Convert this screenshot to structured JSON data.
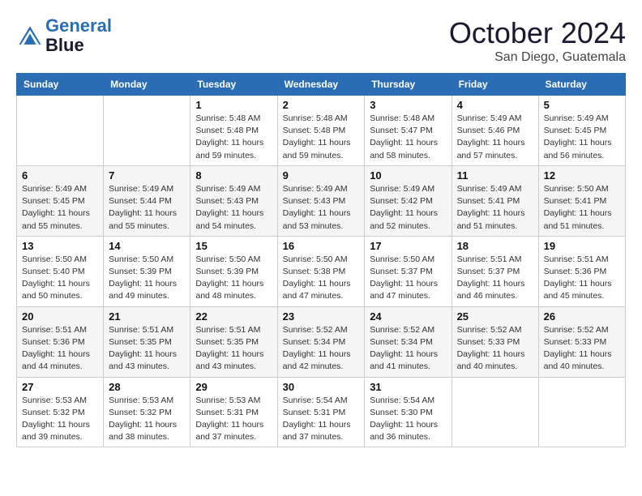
{
  "header": {
    "logo_line1": "General",
    "logo_line2": "Blue",
    "month": "October 2024",
    "location": "San Diego, Guatemala"
  },
  "weekdays": [
    "Sunday",
    "Monday",
    "Tuesday",
    "Wednesday",
    "Thursday",
    "Friday",
    "Saturday"
  ],
  "weeks": [
    [
      {
        "day": "",
        "sunrise": "",
        "sunset": "",
        "daylight": ""
      },
      {
        "day": "",
        "sunrise": "",
        "sunset": "",
        "daylight": ""
      },
      {
        "day": "1",
        "sunrise": "Sunrise: 5:48 AM",
        "sunset": "Sunset: 5:48 PM",
        "daylight": "Daylight: 11 hours and 59 minutes."
      },
      {
        "day": "2",
        "sunrise": "Sunrise: 5:48 AM",
        "sunset": "Sunset: 5:48 PM",
        "daylight": "Daylight: 11 hours and 59 minutes."
      },
      {
        "day": "3",
        "sunrise": "Sunrise: 5:48 AM",
        "sunset": "Sunset: 5:47 PM",
        "daylight": "Daylight: 11 hours and 58 minutes."
      },
      {
        "day": "4",
        "sunrise": "Sunrise: 5:49 AM",
        "sunset": "Sunset: 5:46 PM",
        "daylight": "Daylight: 11 hours and 57 minutes."
      },
      {
        "day": "5",
        "sunrise": "Sunrise: 5:49 AM",
        "sunset": "Sunset: 5:45 PM",
        "daylight": "Daylight: 11 hours and 56 minutes."
      }
    ],
    [
      {
        "day": "6",
        "sunrise": "Sunrise: 5:49 AM",
        "sunset": "Sunset: 5:45 PM",
        "daylight": "Daylight: 11 hours and 55 minutes."
      },
      {
        "day": "7",
        "sunrise": "Sunrise: 5:49 AM",
        "sunset": "Sunset: 5:44 PM",
        "daylight": "Daylight: 11 hours and 55 minutes."
      },
      {
        "day": "8",
        "sunrise": "Sunrise: 5:49 AM",
        "sunset": "Sunset: 5:43 PM",
        "daylight": "Daylight: 11 hours and 54 minutes."
      },
      {
        "day": "9",
        "sunrise": "Sunrise: 5:49 AM",
        "sunset": "Sunset: 5:43 PM",
        "daylight": "Daylight: 11 hours and 53 minutes."
      },
      {
        "day": "10",
        "sunrise": "Sunrise: 5:49 AM",
        "sunset": "Sunset: 5:42 PM",
        "daylight": "Daylight: 11 hours and 52 minutes."
      },
      {
        "day": "11",
        "sunrise": "Sunrise: 5:49 AM",
        "sunset": "Sunset: 5:41 PM",
        "daylight": "Daylight: 11 hours and 51 minutes."
      },
      {
        "day": "12",
        "sunrise": "Sunrise: 5:50 AM",
        "sunset": "Sunset: 5:41 PM",
        "daylight": "Daylight: 11 hours and 51 minutes."
      }
    ],
    [
      {
        "day": "13",
        "sunrise": "Sunrise: 5:50 AM",
        "sunset": "Sunset: 5:40 PM",
        "daylight": "Daylight: 11 hours and 50 minutes."
      },
      {
        "day": "14",
        "sunrise": "Sunrise: 5:50 AM",
        "sunset": "Sunset: 5:39 PM",
        "daylight": "Daylight: 11 hours and 49 minutes."
      },
      {
        "day": "15",
        "sunrise": "Sunrise: 5:50 AM",
        "sunset": "Sunset: 5:39 PM",
        "daylight": "Daylight: 11 hours and 48 minutes."
      },
      {
        "day": "16",
        "sunrise": "Sunrise: 5:50 AM",
        "sunset": "Sunset: 5:38 PM",
        "daylight": "Daylight: 11 hours and 47 minutes."
      },
      {
        "day": "17",
        "sunrise": "Sunrise: 5:50 AM",
        "sunset": "Sunset: 5:37 PM",
        "daylight": "Daylight: 11 hours and 47 minutes."
      },
      {
        "day": "18",
        "sunrise": "Sunrise: 5:51 AM",
        "sunset": "Sunset: 5:37 PM",
        "daylight": "Daylight: 11 hours and 46 minutes."
      },
      {
        "day": "19",
        "sunrise": "Sunrise: 5:51 AM",
        "sunset": "Sunset: 5:36 PM",
        "daylight": "Daylight: 11 hours and 45 minutes."
      }
    ],
    [
      {
        "day": "20",
        "sunrise": "Sunrise: 5:51 AM",
        "sunset": "Sunset: 5:36 PM",
        "daylight": "Daylight: 11 hours and 44 minutes."
      },
      {
        "day": "21",
        "sunrise": "Sunrise: 5:51 AM",
        "sunset": "Sunset: 5:35 PM",
        "daylight": "Daylight: 11 hours and 43 minutes."
      },
      {
        "day": "22",
        "sunrise": "Sunrise: 5:51 AM",
        "sunset": "Sunset: 5:35 PM",
        "daylight": "Daylight: 11 hours and 43 minutes."
      },
      {
        "day": "23",
        "sunrise": "Sunrise: 5:52 AM",
        "sunset": "Sunset: 5:34 PM",
        "daylight": "Daylight: 11 hours and 42 minutes."
      },
      {
        "day": "24",
        "sunrise": "Sunrise: 5:52 AM",
        "sunset": "Sunset: 5:34 PM",
        "daylight": "Daylight: 11 hours and 41 minutes."
      },
      {
        "day": "25",
        "sunrise": "Sunrise: 5:52 AM",
        "sunset": "Sunset: 5:33 PM",
        "daylight": "Daylight: 11 hours and 40 minutes."
      },
      {
        "day": "26",
        "sunrise": "Sunrise: 5:52 AM",
        "sunset": "Sunset: 5:33 PM",
        "daylight": "Daylight: 11 hours and 40 minutes."
      }
    ],
    [
      {
        "day": "27",
        "sunrise": "Sunrise: 5:53 AM",
        "sunset": "Sunset: 5:32 PM",
        "daylight": "Daylight: 11 hours and 39 minutes."
      },
      {
        "day": "28",
        "sunrise": "Sunrise: 5:53 AM",
        "sunset": "Sunset: 5:32 PM",
        "daylight": "Daylight: 11 hours and 38 minutes."
      },
      {
        "day": "29",
        "sunrise": "Sunrise: 5:53 AM",
        "sunset": "Sunset: 5:31 PM",
        "daylight": "Daylight: 11 hours and 37 minutes."
      },
      {
        "day": "30",
        "sunrise": "Sunrise: 5:54 AM",
        "sunset": "Sunset: 5:31 PM",
        "daylight": "Daylight: 11 hours and 37 minutes."
      },
      {
        "day": "31",
        "sunrise": "Sunrise: 5:54 AM",
        "sunset": "Sunset: 5:30 PM",
        "daylight": "Daylight: 11 hours and 36 minutes."
      },
      {
        "day": "",
        "sunrise": "",
        "sunset": "",
        "daylight": ""
      },
      {
        "day": "",
        "sunrise": "",
        "sunset": "",
        "daylight": ""
      }
    ]
  ]
}
